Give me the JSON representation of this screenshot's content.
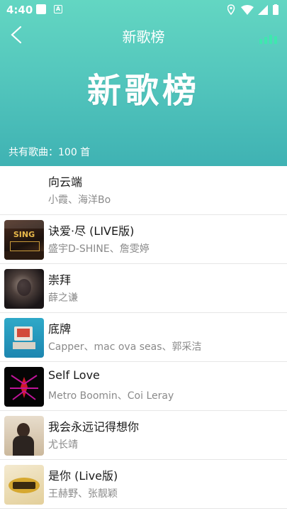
{
  "status": {
    "time": "4:40",
    "notif_icon_letter": "A"
  },
  "nav": {
    "title": "新歌榜",
    "back_icon": "chevron-left-icon",
    "playing_icon": "equalizer-bars-icon",
    "accent": "#3ee8ae"
  },
  "hero": {
    "title": "新歌榜"
  },
  "summary": {
    "count_text": "共有歌曲：100 首"
  },
  "songs": [
    {
      "title": "向云端",
      "artist": "小霞、海洋Bo",
      "cover": "none"
    },
    {
      "title": "诀爱·尽 (LIVE版)",
      "artist": "盛宇D-SHINE、詹雯婷",
      "cover": "sing-china"
    },
    {
      "title": "崇拜",
      "artist": "薛之谦",
      "cover": "smoke-portrait"
    },
    {
      "title": "底牌",
      "artist": "Capper、mac ova seas、郭采洁",
      "cover": "retro-computer"
    },
    {
      "title": "Self Love",
      "artist": "Metro Boomin、Coi Leray",
      "cover": "spider-verse"
    },
    {
      "title": "我会永远记得想你",
      "artist": "尤长靖",
      "cover": "portrait-paper"
    },
    {
      "title": "是你 (Live版)",
      "artist": "王赫野、张靓颖",
      "cover": "sing-china-gold"
    }
  ],
  "colors": {
    "header_top": "#63d6c2",
    "header_bottom": "#3fb2b3",
    "title_text": "#1a1a1a",
    "artist_text": "#8a8a8a"
  }
}
